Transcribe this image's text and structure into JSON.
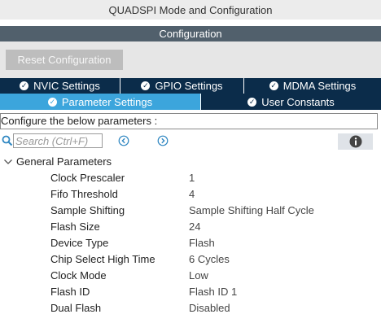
{
  "window": {
    "title": "QUADSPI Mode and Configuration"
  },
  "section": {
    "title": "Configuration"
  },
  "toolbar": {
    "reset_label": "Reset Configuration"
  },
  "tabs": {
    "row1": [
      {
        "label": "NVIC Settings",
        "icon": "check-circle-icon",
        "active": false
      },
      {
        "label": "GPIO Settings",
        "icon": "check-circle-icon",
        "active": false
      },
      {
        "label": "MDMA Settings",
        "icon": "check-circle-icon",
        "active": false
      }
    ],
    "row2": [
      {
        "label": "Parameter Settings",
        "icon": "check-circle-icon",
        "active": true
      },
      {
        "label": "User Constants",
        "icon": "check-circle-icon",
        "active": false
      }
    ]
  },
  "configure_text": "Configure the below parameters :",
  "search": {
    "placeholder": "Search (Ctrl+F)",
    "value": ""
  },
  "group": {
    "title": "General Parameters",
    "expanded": true
  },
  "parameters": [
    {
      "name": "Clock Prescaler",
      "value": "1"
    },
    {
      "name": "Fifo Threshold",
      "value": "4"
    },
    {
      "name": "Sample Shifting",
      "value": "Sample Shifting Half Cycle"
    },
    {
      "name": "Flash Size",
      "value": "24"
    },
    {
      "name": "Device Type",
      "value": "Flash"
    },
    {
      "name": "Chip Select High Time",
      "value": "6 Cycles"
    },
    {
      "name": "Clock Mode",
      "value": "Low"
    },
    {
      "name": "Flash ID",
      "value": "Flash ID 1"
    },
    {
      "name": "Dual Flash",
      "value": "Disabled"
    }
  ],
  "colors": {
    "tab_bg": "#0b2c4a",
    "tab_active": "#3ca5dc",
    "section_bar": "#51606c",
    "nav_icon": "#2e86c1"
  }
}
